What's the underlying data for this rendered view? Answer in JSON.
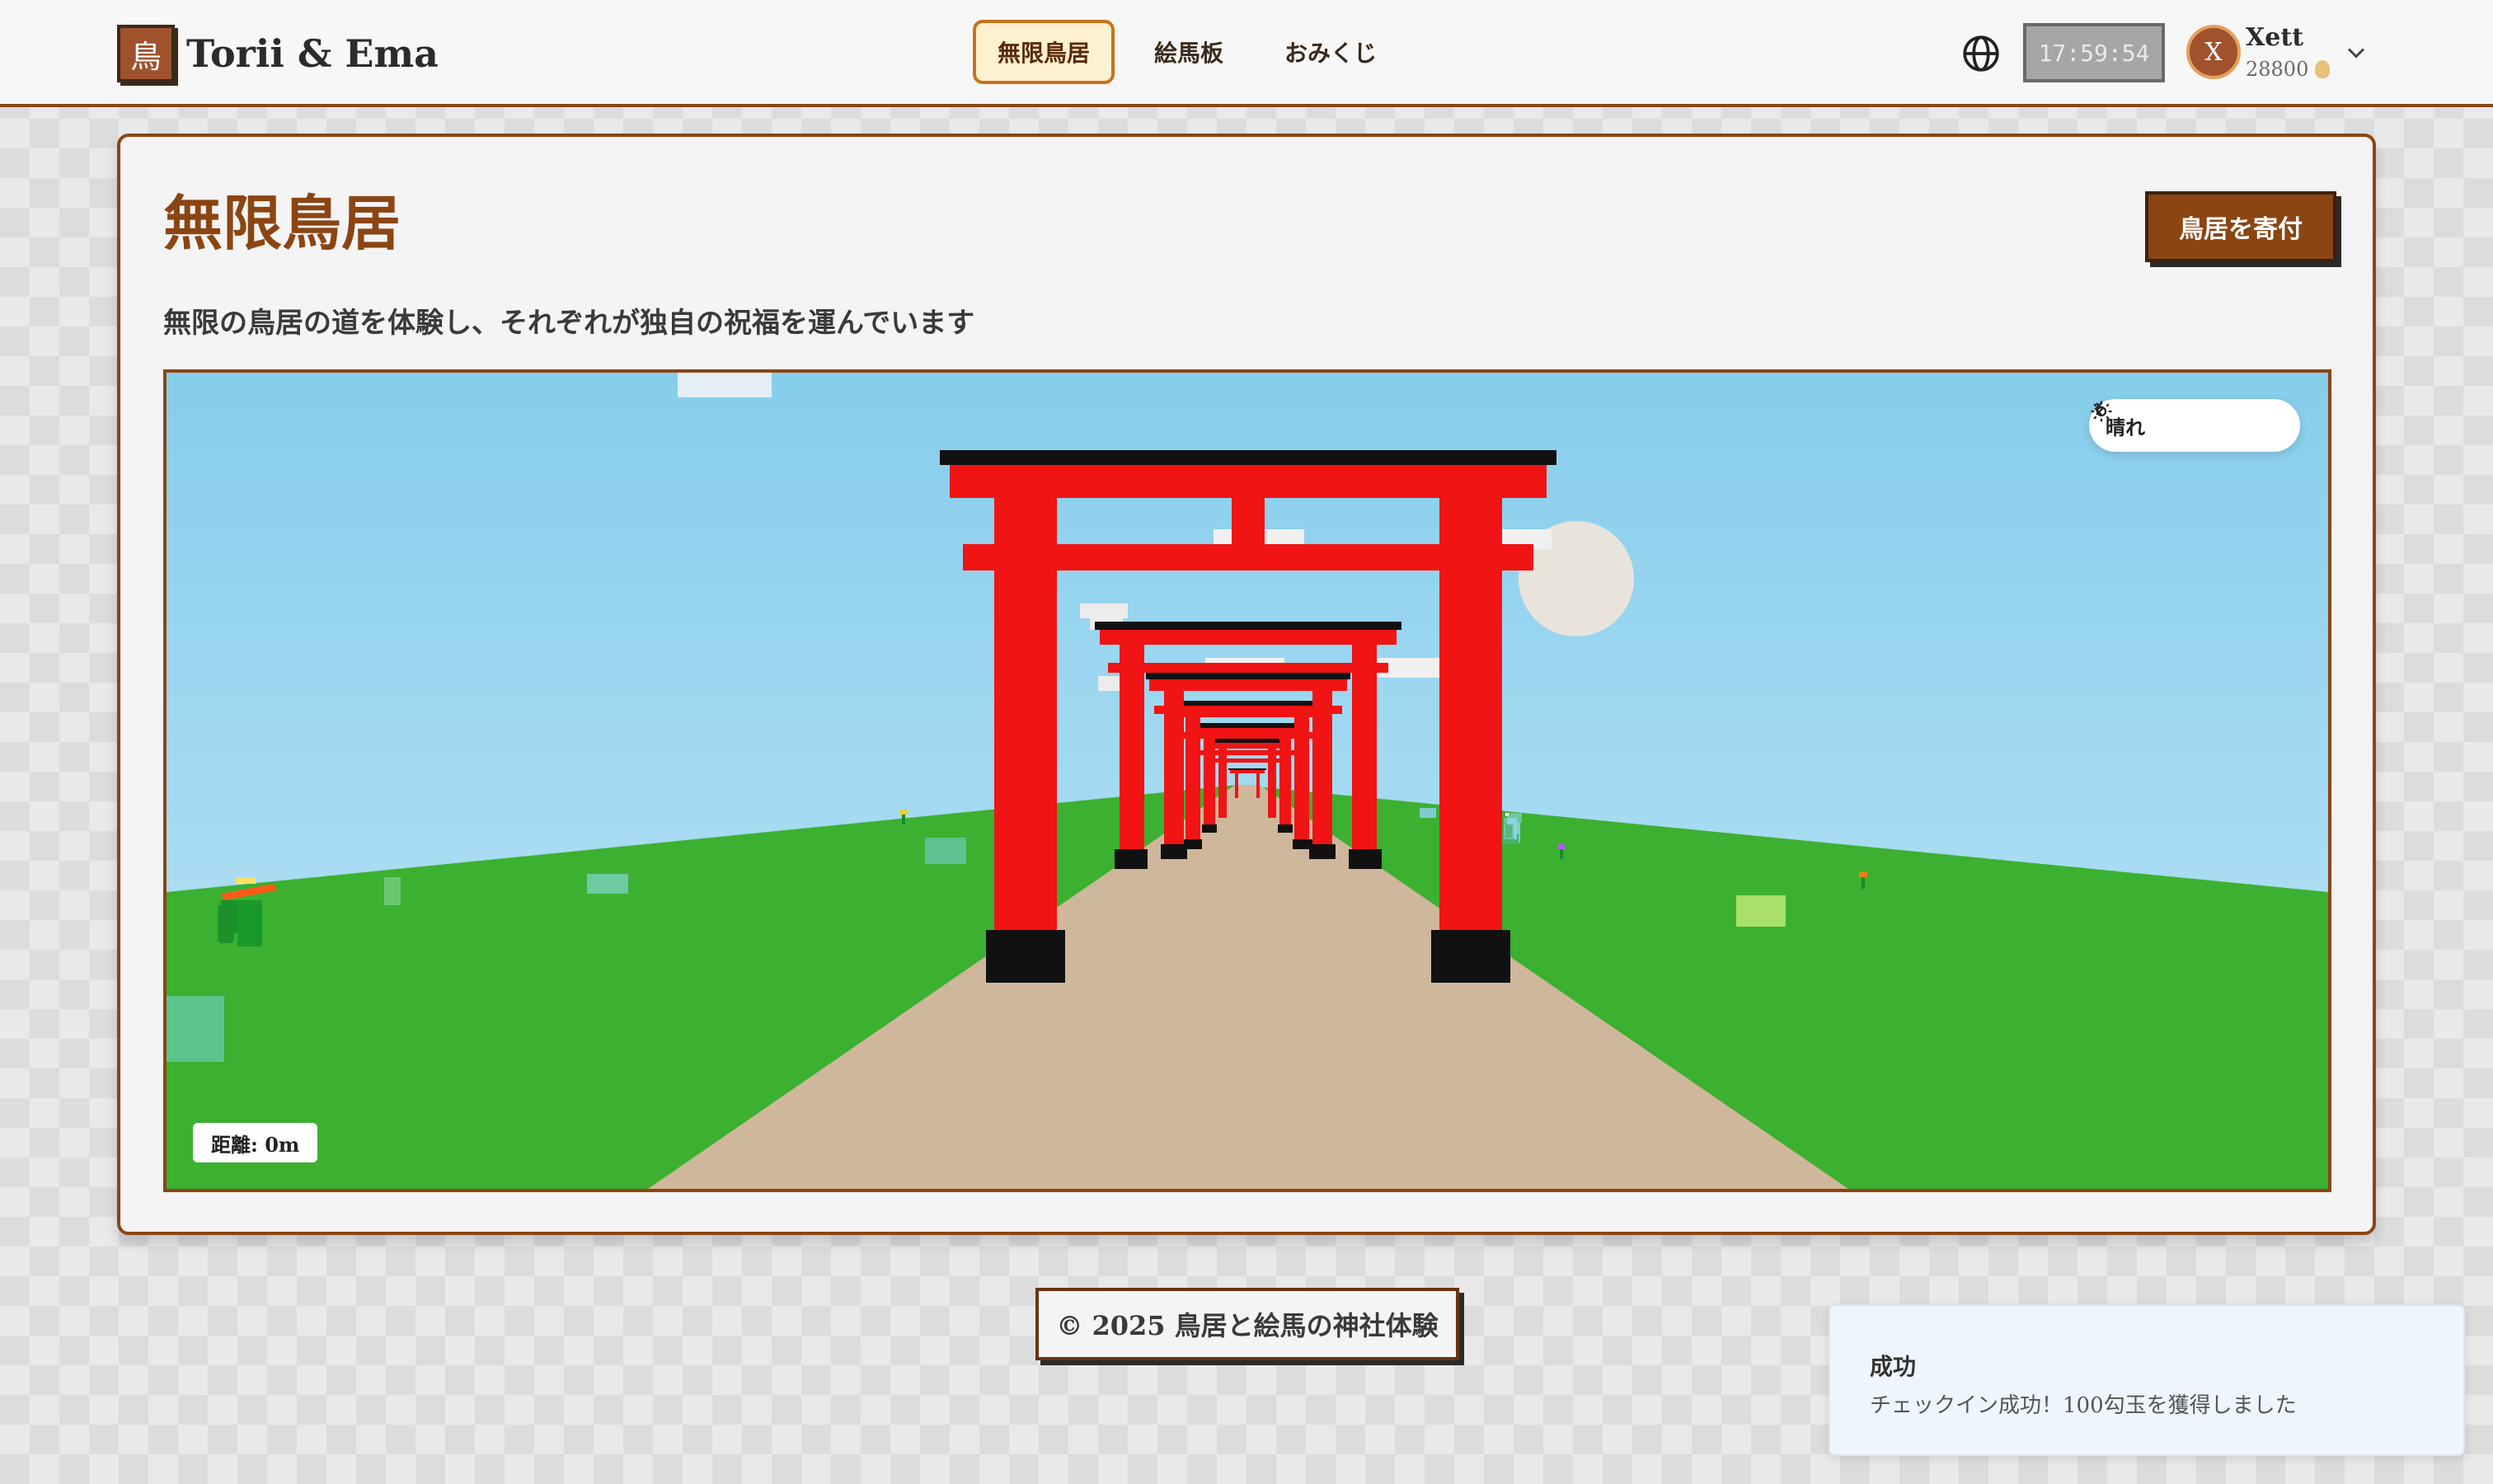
{
  "brand": {
    "logo_char": "鳥",
    "name": "Torii & Ema"
  },
  "nav": [
    {
      "label": "無限鳥居",
      "active": true
    },
    {
      "label": "絵馬板",
      "active": false
    },
    {
      "label": "おみくじ",
      "active": false
    }
  ],
  "header": {
    "clock": "17:59:54",
    "globe_icon": "globe-icon"
  },
  "user": {
    "initial": "X",
    "name": "Xett",
    "coins": "28800",
    "coin_icon": "coin-icon",
    "menu_icon": "chevron-down-icon"
  },
  "main": {
    "title": "無限鳥居",
    "donate_label": "鳥居を寄付",
    "subtitle": "無限の鳥居の道を体験し、それぞれが独自の祝福を運んでいます"
  },
  "scene": {
    "weather_label": "晴れ",
    "weather_icon": "sun-icon",
    "distance_label": "距離: 0m",
    "colors": {
      "sky": "#8fd0ee",
      "ground": "#3cb030",
      "path": "#cfb79c",
      "torii": "#f01414",
      "beam": "#111111"
    }
  },
  "footer": {
    "text": "© 2025 鳥居と絵馬の神社体験"
  },
  "toast": {
    "title": "成功",
    "message": "チェックイン成功！100勾玉を獲得しました"
  }
}
